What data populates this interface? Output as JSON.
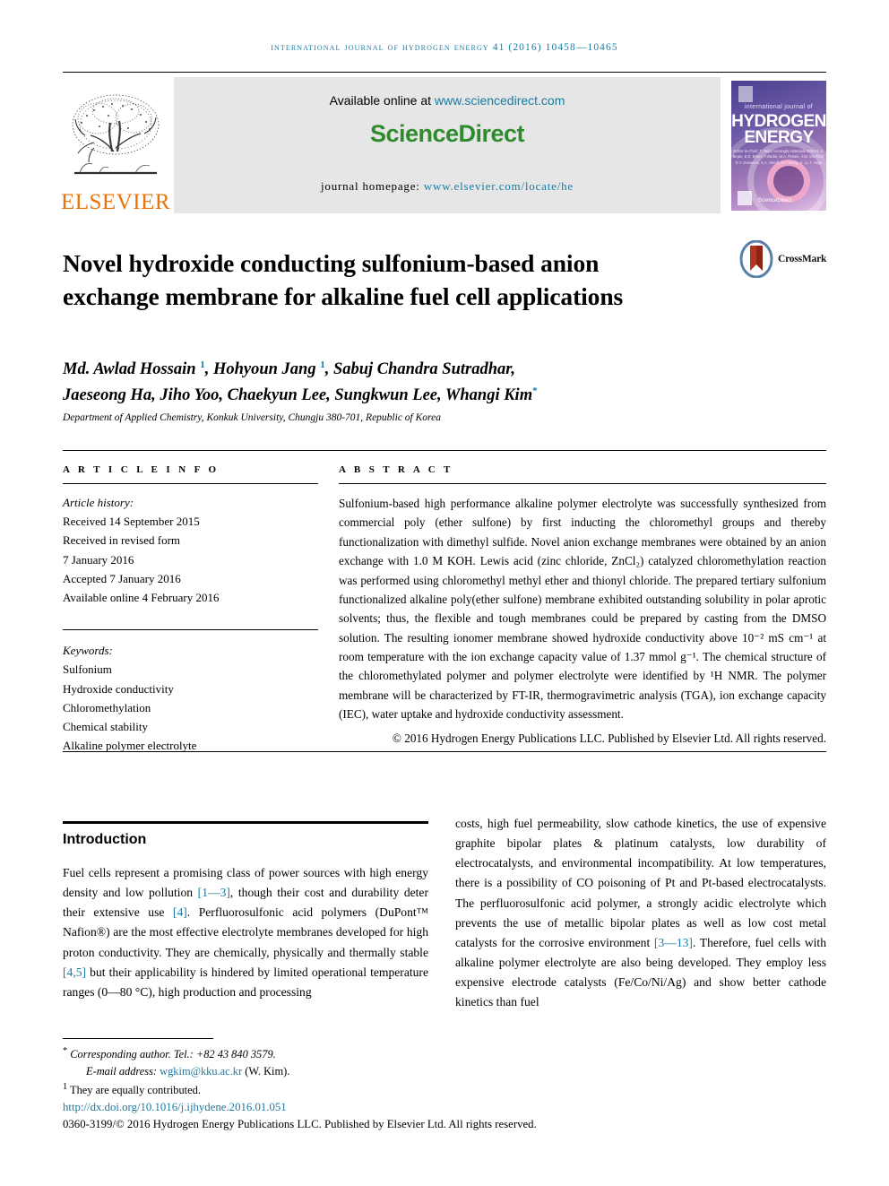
{
  "running_head": "International Journal of Hydrogen Energy 41 (2016) 10458—10465",
  "masthead": {
    "publisher_name": "ELSEVIER",
    "available_text": "Available online at",
    "available_url": "www.sciencedirect.com",
    "sciencedirect_science": "Science",
    "sciencedirect_direct": "Direct",
    "homepage_label": "journal homepage:",
    "homepage_url": "www.elsevier.com/locate/he",
    "cover": {
      "eyebrow": "international journal of",
      "line1": "HYDROGEN",
      "line2": "ENERGY",
      "editors": "Editor-in-Chief: T. Nejat Veziroglu  Associate Editors: A. Bejan, E.E. Ersen, F.Barbir, M.A. Rosen, J.W. Sheffield, D.Y. Goswami, S.A. Sherif, Z.F. Wang, X. Li, T. Nejat",
      "sd_text": "ScienceDirect"
    }
  },
  "article": {
    "title": "Novel hydroxide conducting sulfonium-based anion exchange membrane for alkaline fuel cell applications",
    "crossmark_label": "CrossMark",
    "authors_line1_a": "Md. Awlad Hossain ",
    "authors_sup1": "1",
    "authors_line1_b": ", Hohyoun Jang ",
    "authors_sup2": "1",
    "authors_line1_c": ", Sabuj Chandra Sutradhar,",
    "authors_line2_a": "Jaeseong Ha, Jiho Yoo, Chaekyun Lee, Sungkwun Lee, Whangi Kim",
    "authors_sup3": "*",
    "affiliation": "Department of Applied Chemistry, Konkuk University, Chungju 380-701, Republic of Korea"
  },
  "article_info": {
    "heading": "A R T I C L E   I N F O",
    "history_label": "Article history:",
    "received": "Received 14 September 2015",
    "revised_label": "Received in revised form",
    "revised_date": "7 January 2016",
    "accepted": "Accepted 7 January 2016",
    "available_online": "Available online 4 February 2016",
    "keywords_label": "Keywords:",
    "keywords": [
      "Sulfonium",
      "Hydroxide conductivity",
      "Chloromethylation",
      "Chemical stability",
      "Alkaline polymer electrolyte"
    ]
  },
  "abstract": {
    "heading": "A B S T R A C T",
    "body": "Sulfonium-based high performance alkaline polymer electrolyte was successfully synthesized from commercial poly (ether sulfone) by first inducting the chloromethyl groups and thereby functionalization with dimethyl sulfide. Novel anion exchange membranes were obtained by an anion exchange with 1.0 M KOH. Lewis acid (zinc chloride, ZnCl₂) catalyzed chloromethylation reaction was performed using chloromethyl methyl ether and thionyl chloride. The prepared tertiary sulfonium functionalized alkaline poly(ether sulfone) membrane exhibited outstanding solubility in polar aprotic solvents; thus, the flexible and tough membranes could be prepared by casting from the DMSO solution. The resulting ionomer membrane showed hydroxide conductivity above 10⁻² mS cm⁻¹ at room temperature with the ion exchange capacity value of 1.37 mmol g⁻¹. The chemical structure of the chloromethylated polymer and polymer electrolyte were identified by ¹H NMR. The polymer membrane will be characterized by FT-IR, thermogravimetric analysis (TGA), ion exchange capacity (IEC), water uptake and hydroxide conductivity assessment.",
    "copyright": "© 2016 Hydrogen Energy Publications LLC. Published by Elsevier Ltd. All rights reserved."
  },
  "introduction": {
    "heading": "Introduction",
    "left_a": "Fuel cells represent a promising class of power sources with high energy density and low pollution ",
    "left_ref1": "[1—3]",
    "left_b": ", though their cost and durability deter their extensive use ",
    "left_ref2": "[4]",
    "left_c": ". Perfluorosulfonic acid polymers (DuPont™ Nafion®) are the most effective electrolyte membranes developed for high proton conductivity. They are chemically, physically and thermally stable ",
    "left_ref3": "[4,5]",
    "left_d": " but their applicability is hindered by limited operational temperature ranges (0—80 °C), high production and processing",
    "right_a": "costs, high fuel permeability, slow cathode kinetics, the use of expensive graphite bipolar plates & platinum catalysts, low durability of electrocatalysts, and environmental incompatibility. At low temperatures, there is a possibility of CO poisoning of Pt and Pt-based electrocatalysts. The perfluorosulfonic acid polymer, a strongly acidic electrolyte which prevents the use of metallic bipolar plates as well as low cost metal catalysts for the corrosive environment ",
    "right_ref1": "[3—13]",
    "right_b": ". Therefore, fuel cells with alkaline polymer electrolyte are also being developed. They employ less expensive electrode catalysts (Fe/Co/Ni/Ag) and show better cathode kinetics than fuel"
  },
  "footer": {
    "corresponding_marker": "*",
    "corresponding": "Corresponding author. Tel.: +82 43 840 3579.",
    "email_label": "E-mail address:",
    "email": "wgkim@kku.ac.kr",
    "email_suffix": "(W. Kim).",
    "equal_marker": "1",
    "equal_contrib": "They are equally contributed.",
    "doi": "http://dx.doi.org/10.1016/j.ijhydene.2016.01.051",
    "copyright": "0360-3199/© 2016 Hydrogen Energy Publications LLC. Published by Elsevier Ltd. All rights reserved."
  },
  "colors": {
    "link": "#1a7ba4",
    "elsevier_orange": "#E8740C",
    "sciencedirect_green": "#2e8b2e"
  }
}
